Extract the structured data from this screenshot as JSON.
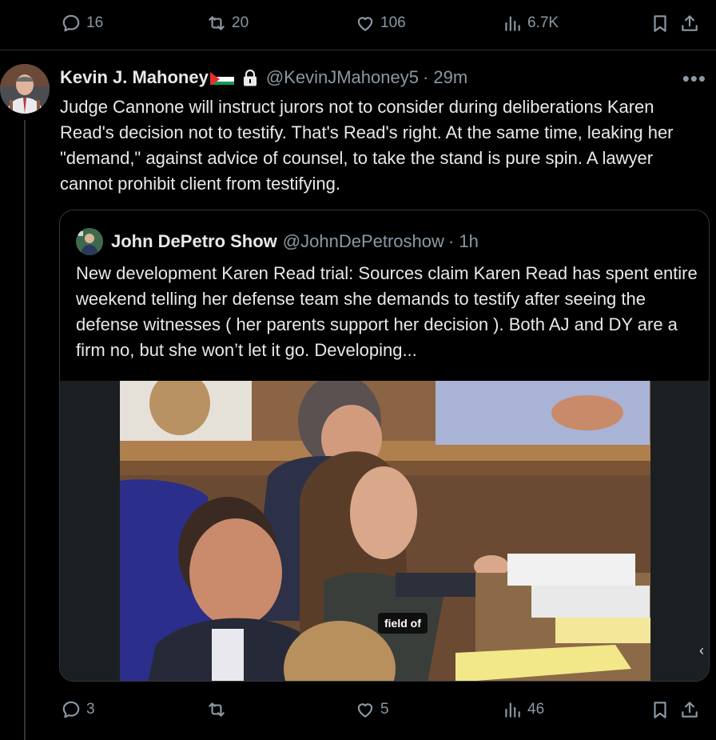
{
  "top_actions": {
    "replies": "16",
    "retweets": "20",
    "likes": "106",
    "views": "6.7K"
  },
  "tweet": {
    "author_name": "Kevin J. Mahoney",
    "handle": "@KevinJMahoney5",
    "time": "· 29m",
    "more": "•••",
    "text": "Judge Cannone will instruct jurors not to consider during deliberations Karen Read's decision not to testify. That's Read's right. At the same time, leaking her \"demand,\" against advice of counsel, to take the stand is pure spin. A lawyer cannot prohibit client from testifying."
  },
  "quote": {
    "author_name": "John DePetro Show",
    "handle": "@JohnDePetroshow",
    "time": "· 1h",
    "text": "New development Karen Read trial: Sources claim Karen Read has spent entire weekend telling her defense team she demands to testify after seeing the defense witnesses ( her parents support her decision ). Both AJ and DY are a firm no, but she won’t let it go. Developing...",
    "media_badge": "field of",
    "media_arrow": "‹"
  },
  "bottom_actions": {
    "replies": "3",
    "retweets": "",
    "likes": "5",
    "views": "46"
  },
  "icons": {
    "reply": "reply-icon",
    "retweet": "retweet-icon",
    "like": "heart-icon",
    "views": "views-icon",
    "bookmark": "bookmark-icon",
    "share": "share-icon",
    "lock": "lock-icon",
    "flag": "palestine-flag-icon"
  },
  "colors": {
    "background": "#000000",
    "text": "#e7e9ea",
    "muted": "#8b98a5",
    "border": "#2f3336"
  }
}
